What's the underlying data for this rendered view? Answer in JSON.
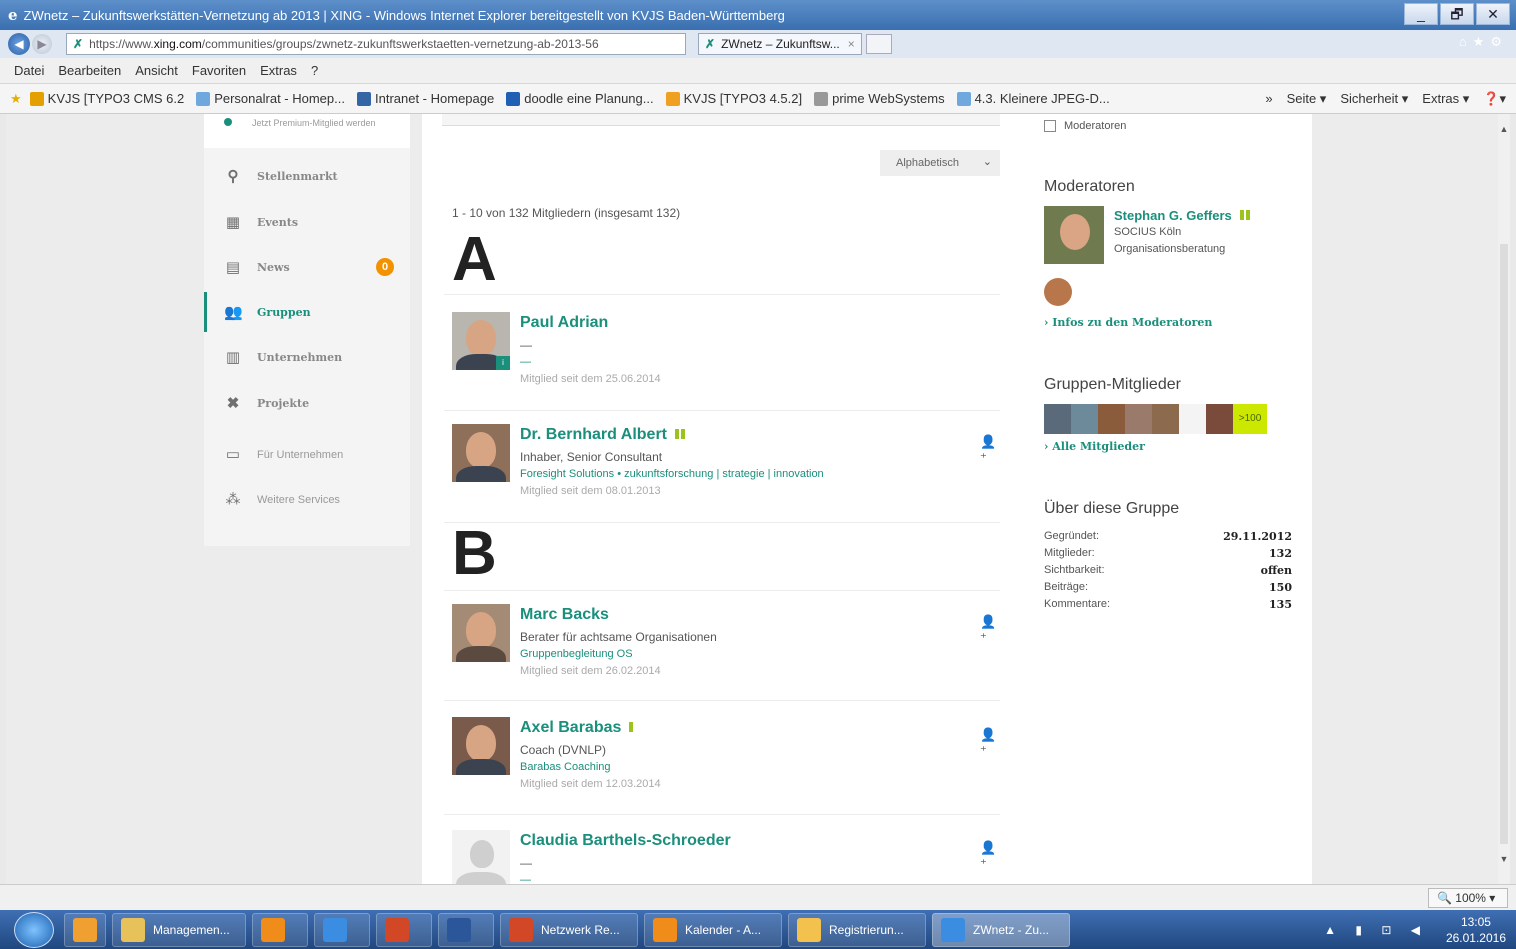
{
  "window": {
    "title": "ZWnetz – Zukunftswerkstätten-Vernetzung ab 2013 | XING - Windows Internet Explorer bereitgestellt von KVJS Baden-Württemberg",
    "buttons": [
      "_",
      "🗗",
      "✕"
    ]
  },
  "address": {
    "url_prefix": "https://www.",
    "url_domain": "xing.com",
    "url_path": "/communities/groups/zwnetz-zukunftswerkstaetten-vernetzung-ab-2013-56",
    "tab_title": "ZWnetz – Zukunftsw...",
    "tab_close": "×"
  },
  "menu": [
    "Datei",
    "Bearbeiten",
    "Ansicht",
    "Favoriten",
    "Extras",
    "?"
  ],
  "favorites": [
    {
      "label": "KVJS [TYPO3 CMS 6.2",
      "color": "#e3a000"
    },
    {
      "label": "Personalrat - Homep...",
      "color": "#6fa8dc"
    },
    {
      "label": "Intranet - Homepage",
      "color": "#3465a4"
    },
    {
      "label": "doodle eine Planung...",
      "color": "#1f5fb4"
    },
    {
      "label": "KVJS [TYPO3 4.5.2]",
      "color": "#f0a020"
    },
    {
      "label": "prime WebSystems",
      "color": "#999999"
    },
    {
      "label": "4.3. Kleinere JPEG-D...",
      "color": "#6fa8dc"
    }
  ],
  "favbar_right": [
    "»",
    "Seite ▾",
    "Sicherheit ▾",
    "Extras ▾",
    "❓▾"
  ],
  "sidebar": {
    "premium_text": "Jetzt Premium-Mitglied werden",
    "items": [
      {
        "label": "Stellenmarkt",
        "icon": "⚲"
      },
      {
        "label": "Events",
        "icon": "▦"
      },
      {
        "label": "News",
        "icon": "▤",
        "badge": "0"
      },
      {
        "label": "Gruppen",
        "icon": "👥"
      },
      {
        "label": "Unternehmen",
        "icon": "▥"
      },
      {
        "label": "Projekte",
        "icon": "✖"
      },
      {
        "label": "Für Unternehmen",
        "icon": "▭"
      },
      {
        "label": "Weitere Services",
        "icon": "⁂"
      }
    ]
  },
  "main": {
    "sort_label": "Alphabetisch",
    "sort_chevron": "⌄",
    "member_count": "1 - 10 von 132 Mitgliedern (insgesamt 132)",
    "letters": [
      "A",
      "B"
    ],
    "members": [
      {
        "name": "Paul Adrian",
        "role": "—",
        "company": "—",
        "since": "Mitglied seit dem 25.06.2014",
        "premium": false,
        "photo": "#b9b6b0",
        "add_icon": ""
      },
      {
        "name": "Dr. Bernhard Albert",
        "role": "Inhaber, Senior Consultant",
        "company": "Foresight Solutions • zukunftsforschung | strategie | innovation",
        "since": "Mitglied seit dem 08.01.2013",
        "premium": true,
        "photo": "#8d6f5a",
        "add_icon": "👤⁺"
      },
      {
        "name": "Marc Backs",
        "role": "Berater für achtsame Organisationen",
        "company": "Gruppenbegleitung OS",
        "since": "Mitglied seit dem 26.02.2014",
        "premium": false,
        "photo": "#a38b75",
        "add_icon": "👤⁺"
      },
      {
        "name": "Axel Barabas",
        "role": "Coach (DVNLP)",
        "company": "Barabas Coaching",
        "since": "Mitglied seit dem 12.03.2014",
        "premium": true,
        "photo": "#7a5a4a",
        "add_icon": "👤⁺"
      },
      {
        "name": "Claudia Barthels-Schroeder",
        "role": "—",
        "company": "—",
        "since": "",
        "premium": false,
        "photo": "placeholder",
        "add_icon": "👤⁺"
      }
    ]
  },
  "right": {
    "moderator_filter": "Moderatoren",
    "moderators_heading": "Moderatoren",
    "moderator": {
      "name": "Stephan G. Geffers",
      "company": "SOCIUS Köln",
      "role": "Organisationsberatung"
    },
    "moderators_link": "› Infos zu den Moderatoren",
    "members_heading": "Gruppen-Mitglieder",
    "member_thumbs": [
      "#5b6a7a",
      "#6d8a9a",
      "#8a5c3c",
      "#9a7a6a",
      "#8c6a4e",
      "#f4f4f4",
      "#7a4a3a",
      "#a56b50"
    ],
    "members_more": ">100",
    "members_link": "› Alle Mitglieder",
    "about_heading": "Über diese Gruppe",
    "about": [
      {
        "label": "Gegründet:",
        "value": "29.11.2012"
      },
      {
        "label": "Mitglieder:",
        "value": "132"
      },
      {
        "label": "Sichtbarkeit:",
        "value": "offen"
      },
      {
        "label": "Beiträge:",
        "value": "150"
      },
      {
        "label": "Kommentare:",
        "value": "135"
      }
    ]
  },
  "statusbar": {
    "zoom": "🔍 100%  ▾"
  },
  "taskbar": {
    "tasks": [
      {
        "label": "",
        "color": "#f0a030"
      },
      {
        "label": "Managemen...",
        "color": "#e7c15a"
      },
      {
        "label": "",
        "color": "#f08c1a"
      },
      {
        "label": "",
        "color": "#3a8de0"
      },
      {
        "label": "",
        "color": "#d24726"
      },
      {
        "label": "",
        "color": "#2b579a"
      },
      {
        "label": "Netzwerk Re...",
        "color": "#d24726"
      },
      {
        "label": "Kalender - A...",
        "color": "#f08c1a"
      },
      {
        "label": "Registrierun...",
        "color": "#f2c14e"
      },
      {
        "label": "ZWnetz - Zu...",
        "color": "#3a8de0"
      }
    ],
    "tray_icons": "▲ ▮ ⊡ ◀",
    "time": "13:05",
    "date": "26.01.2016"
  }
}
